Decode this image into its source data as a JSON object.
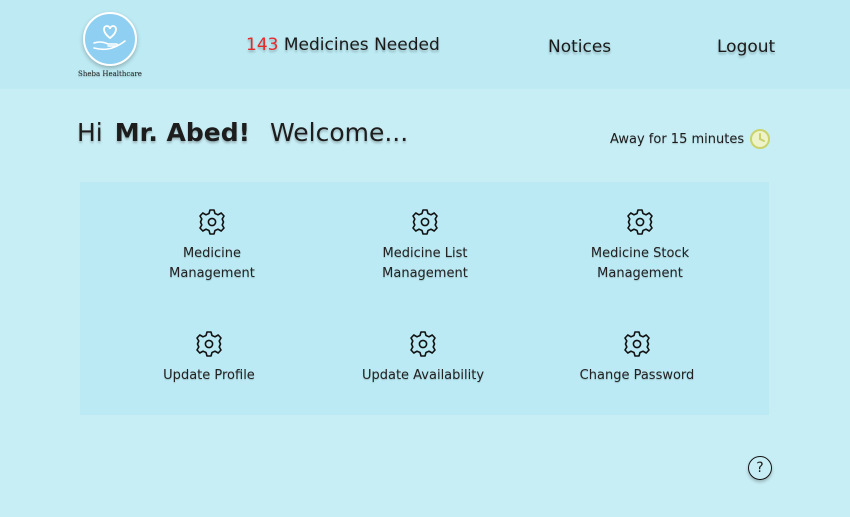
{
  "brand": {
    "name": "Sheba Healthcare",
    "logo_icon": "heart-in-hand-icon"
  },
  "nav": {
    "needed_count": "143",
    "needed_label": "Medicines Needed",
    "notices": "Notices",
    "logout": "Logout"
  },
  "greeting": {
    "hi": "Hi",
    "name": "Mr. Abed!",
    "welcome": "Welcome..."
  },
  "status": {
    "away_text": "Away for 15 minutes",
    "icon": "clock-icon",
    "icon_color": "#c9d36a"
  },
  "tiles": [
    {
      "label_line1": "Medicine",
      "label_line2": "Management",
      "icon": "gear-icon"
    },
    {
      "label_line1": "Medicine List",
      "label_line2": "Management",
      "icon": "gear-icon"
    },
    {
      "label_line1": "Medicine Stock",
      "label_line2": "Management",
      "icon": "gear-icon"
    },
    {
      "label_line1": "Update Profile",
      "icon": "gear-icon"
    },
    {
      "label_line1": "Update Availability",
      "icon": "gear-icon"
    },
    {
      "label_line1": "Change Password",
      "icon": "gear-icon"
    }
  ],
  "help": {
    "symbol": "?",
    "icon": "help-icon"
  },
  "colors": {
    "background": "#c8eef5",
    "topbar": "#bdeaf3",
    "panel": "#bbeaf4",
    "alert": "#e52a2a"
  }
}
